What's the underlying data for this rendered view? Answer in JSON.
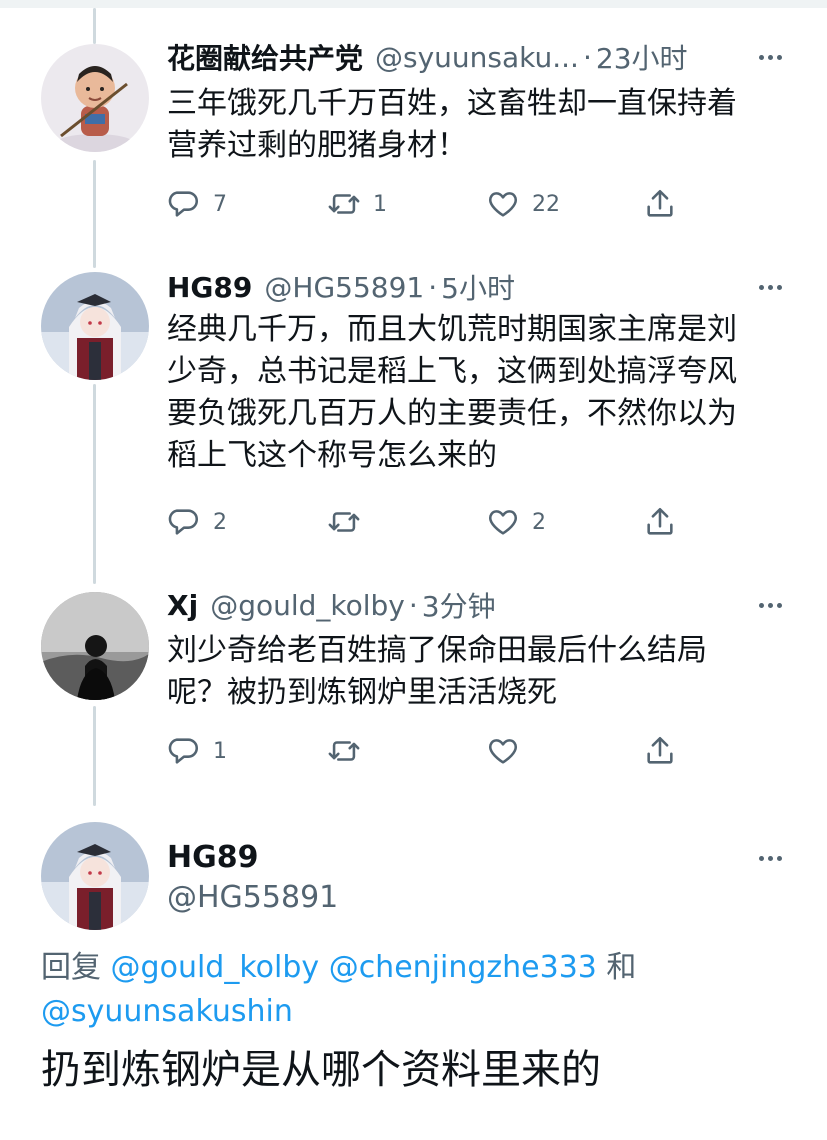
{
  "replies": [
    {
      "name": "花圈献给共产党",
      "handle": "@syuunsaku...",
      "separator": "·",
      "time": "23小时",
      "text": "三年饿死几千万百姓，这畜牲却一直保持着\n营养过剩的肥猪身材！",
      "counts": {
        "reply": "7",
        "retweet": "1",
        "like": "22"
      }
    },
    {
      "name": "HG89",
      "handle": "@HG55891",
      "separator": "·",
      "time": "5小时",
      "text": "经典几千万，而且大饥荒时期国家主席是刘\n少奇，总书记是稻上飞，这俩到处搞浮夸风\n要负饿死几百万人的主要责任，不然你以为\n稻上飞这个称号怎么来的",
      "counts": {
        "reply": "2",
        "retweet": "",
        "like": "2"
      }
    },
    {
      "name": "Xj",
      "handle": "@gould_kolby",
      "separator": "·",
      "time": "3分钟",
      "text": "刘少奇给老百姓搞了保命田最后什么结局\n呢？被扔到炼钢炉里活活烧死",
      "counts": {
        "reply": "1",
        "retweet": "",
        "like": ""
      }
    }
  ],
  "main_tweet": {
    "name": "HG89",
    "handle": "@HG55891",
    "reply_prefix": "回复",
    "reply_users": [
      "@gould_kolby",
      "@chenjingzhe333",
      "@syuunsakushin"
    ],
    "reply_conjunction": "和",
    "text": "扔到炼钢炉是从哪个资料里来的"
  },
  "icons": [
    "reply-icon",
    "retweet-icon",
    "like-icon",
    "share-icon",
    "more-icon"
  ],
  "colors": {
    "text": "#0f1419",
    "secondary": "#536471",
    "link": "#1d9bf0",
    "thread_line": "#cfd9de"
  }
}
